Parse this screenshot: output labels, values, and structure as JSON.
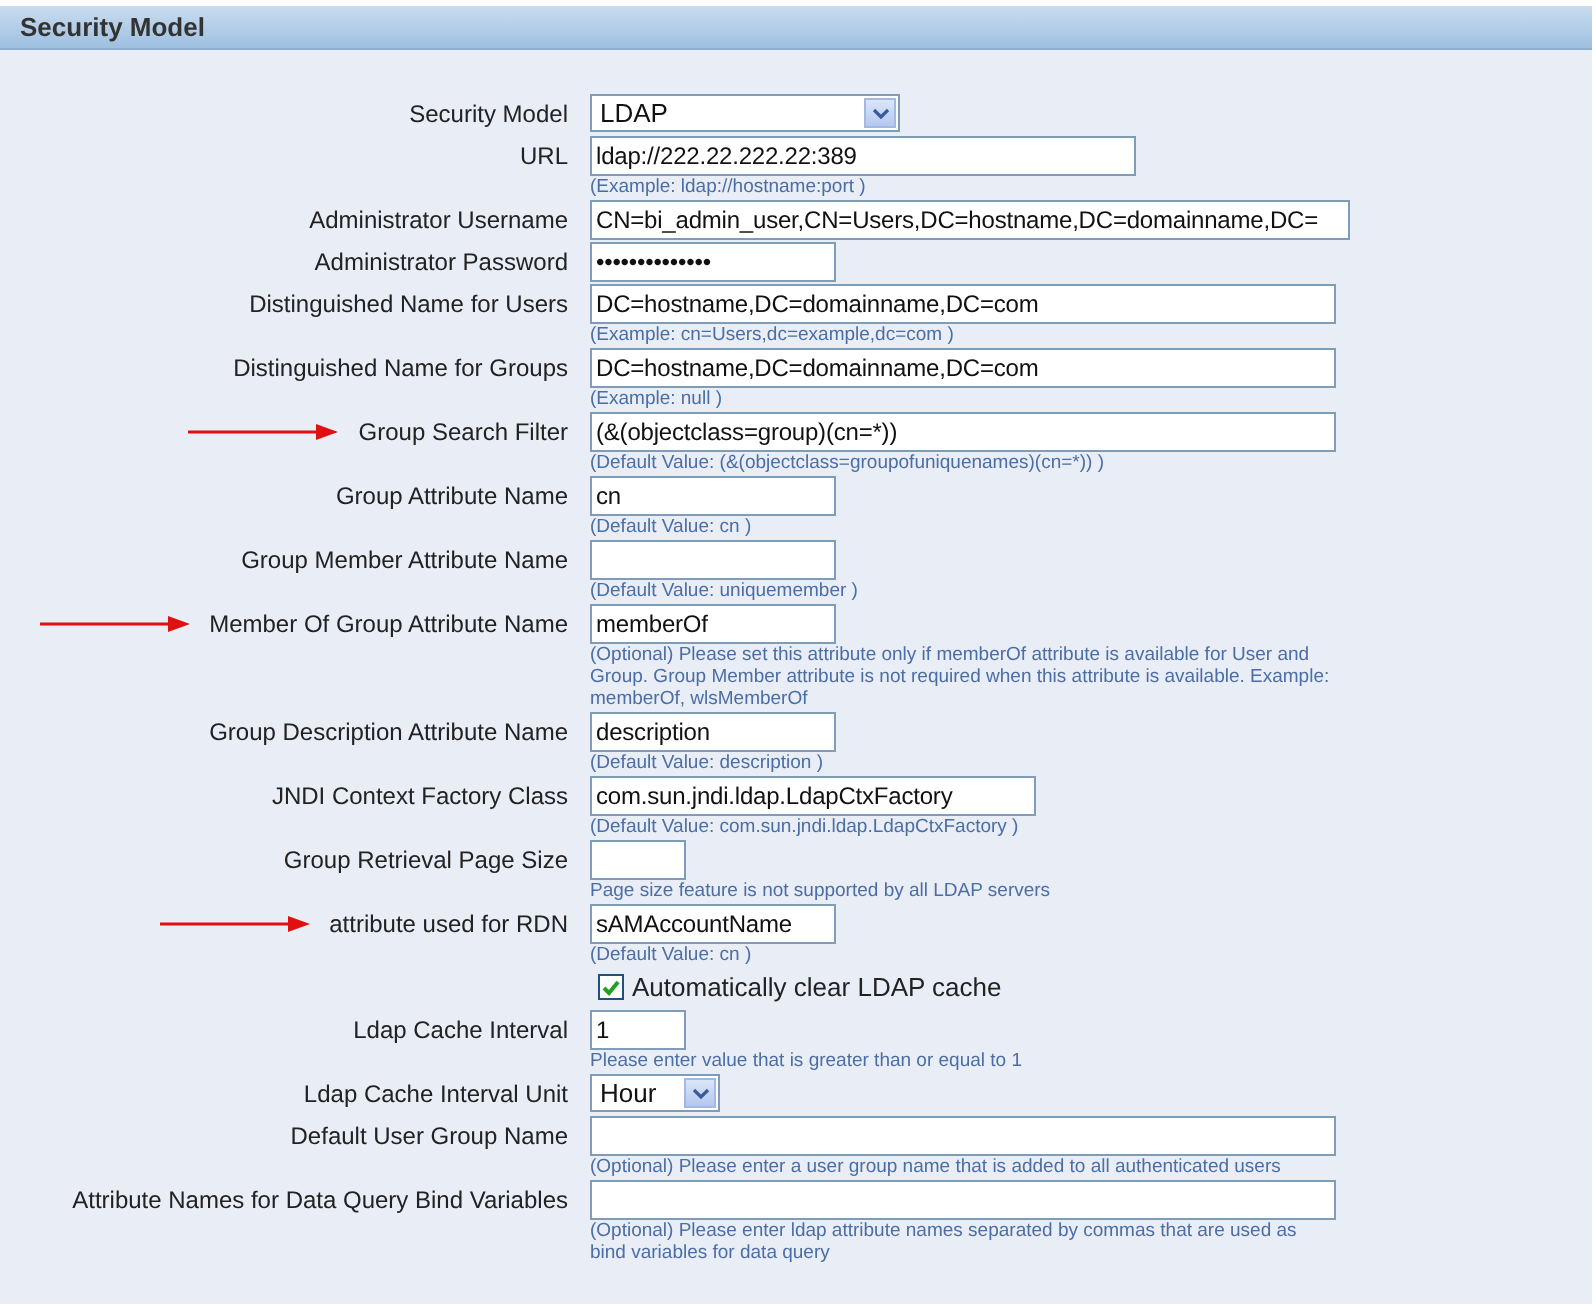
{
  "panel": {
    "title": "Security Model"
  },
  "fields": [
    {
      "kind": "select",
      "label": "Security Model",
      "value": "LDAP",
      "marked": false
    },
    {
      "kind": "text",
      "label": "URL",
      "value": "ldap://222.22.222.22:389",
      "hint": "(Example: ldap://hostname:port )",
      "marked": false
    },
    {
      "kind": "text",
      "label": "Administrator Username",
      "value": "CN=bi_admin_user,CN=Users,DC=hostname,DC=domainname,DC=",
      "marked": false
    },
    {
      "kind": "password",
      "label": "Administrator Password",
      "value": "••••••••••••••",
      "marked": false
    },
    {
      "kind": "text",
      "label": "Distinguished Name for Users",
      "value": "DC=hostname,DC=domainname,DC=com",
      "hint": "(Example: cn=Users,dc=example,dc=com )",
      "marked": false
    },
    {
      "kind": "text",
      "label": "Distinguished Name for Groups",
      "value": "DC=hostname,DC=domainname,DC=com",
      "hint": "(Example: null )",
      "marked": false
    },
    {
      "kind": "text",
      "label": "Group Search Filter",
      "value": "(&(objectclass=group)(cn=*))",
      "hint": "(Default Value: (&(objectclass=groupofuniquenames)(cn=*)) )",
      "marked": true
    },
    {
      "kind": "text",
      "label": "Group Attribute Name",
      "value": "cn",
      "hint": "(Default Value: cn )",
      "marked": false
    },
    {
      "kind": "text",
      "label": "Group Member Attribute Name",
      "hint": "(Default Value: uniquemember )",
      "marked": false
    },
    {
      "kind": "text",
      "label": "Member Of Group Attribute Name",
      "value": "memberOf",
      "hint": "(Optional) Please set this attribute only if memberOf attribute is available for User and Group. Group Member attribute is not required when this attribute is available. Example: memberOf, wlsMemberOf",
      "marked": true
    },
    {
      "kind": "text",
      "label": "Group Description Attribute Name",
      "value": "description",
      "hint": "(Default Value: description )",
      "marked": false
    },
    {
      "kind": "text",
      "label": "JNDI Context Factory Class",
      "value": "com.sun.jndi.ldap.LdapCtxFactory",
      "hint": "(Default Value: com.sun.jndi.ldap.LdapCtxFactory )",
      "marked": false
    },
    {
      "kind": "text",
      "label": "Group Retrieval Page Size",
      "hint": "Page size feature is not supported by all LDAP servers",
      "marked": false
    },
    {
      "kind": "text",
      "label": "attribute used for RDN",
      "value": "sAMAccountName",
      "hint": "(Default Value: cn )",
      "marked": true
    },
    {
      "kind": "checkbox",
      "label": "Automatically clear LDAP cache",
      "checked": true,
      "marked": false
    },
    {
      "kind": "text",
      "label": "Ldap Cache Interval",
      "value": "1",
      "hint": "Please enter value that is greater than or equal to 1",
      "marked": false
    },
    {
      "kind": "select",
      "label": "Ldap Cache Interval Unit",
      "value": "Hour",
      "marked": false
    },
    {
      "kind": "text",
      "label": "Default User Group Name",
      "hint": "(Optional) Please enter a user group name that is added to all authenticated users",
      "marked": false
    },
    {
      "kind": "text",
      "label": "Attribute Names for Data Query Bind Variables",
      "hint": "(Optional) Please enter ldap attribute names separated by commas that are used as bind variables for data query",
      "marked": false
    }
  ]
}
